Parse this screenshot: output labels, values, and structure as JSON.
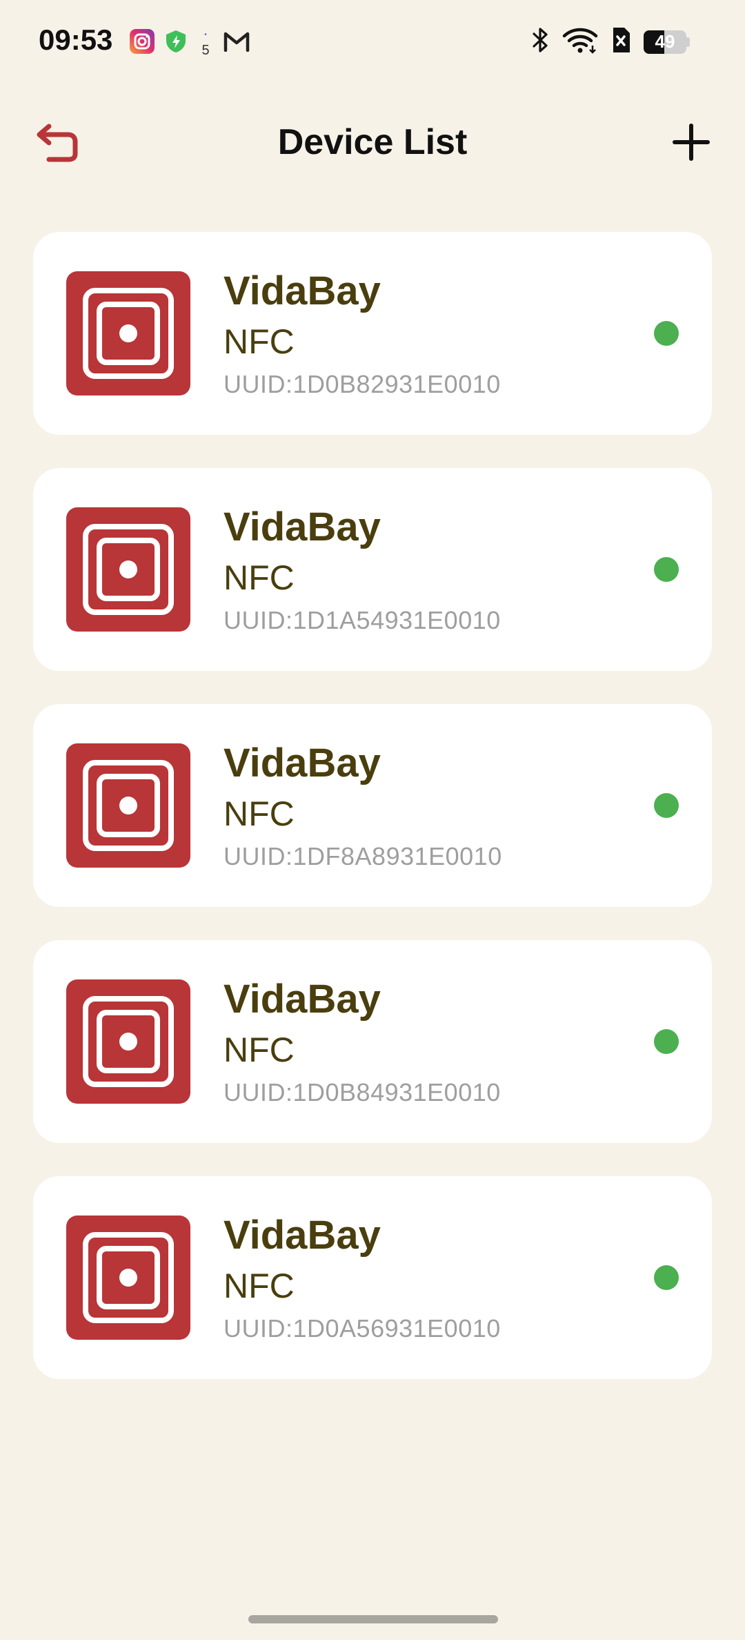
{
  "status_bar": {
    "time": "09:53",
    "notification_badge": "5",
    "battery_level": "49",
    "battery_fraction": 0.49,
    "icons": [
      "instagram-icon",
      "shield-icon",
      "notification-count-icon",
      "gmail-icon",
      "bluetooth-icon",
      "wifi-icon",
      "sim-off-icon",
      "battery-icon"
    ]
  },
  "header": {
    "title": "Device List",
    "back_icon": "back-arrow-icon",
    "add_icon": "plus-icon"
  },
  "colors": {
    "background": "#f7f2e8",
    "card": "#ffffff",
    "accent_red": "#b83538",
    "device_name": "#4a3e0e",
    "uuid_grey": "#9e9e9e",
    "status_online": "#4caf50"
  },
  "devices": [
    {
      "name": "VidaBay",
      "type": "NFC",
      "uuid": "UUID:1D0B82931E0010",
      "status": "online"
    },
    {
      "name": "VidaBay",
      "type": "NFC",
      "uuid": "UUID:1D1A54931E0010",
      "status": "online"
    },
    {
      "name": "VidaBay",
      "type": "NFC",
      "uuid": "UUID:1DF8A8931E0010",
      "status": "online"
    },
    {
      "name": "VidaBay",
      "type": "NFC",
      "uuid": "UUID:1D0B84931E0010",
      "status": "online"
    },
    {
      "name": "VidaBay",
      "type": "NFC",
      "uuid": "UUID:1D0A56931E0010",
      "status": "online"
    }
  ]
}
